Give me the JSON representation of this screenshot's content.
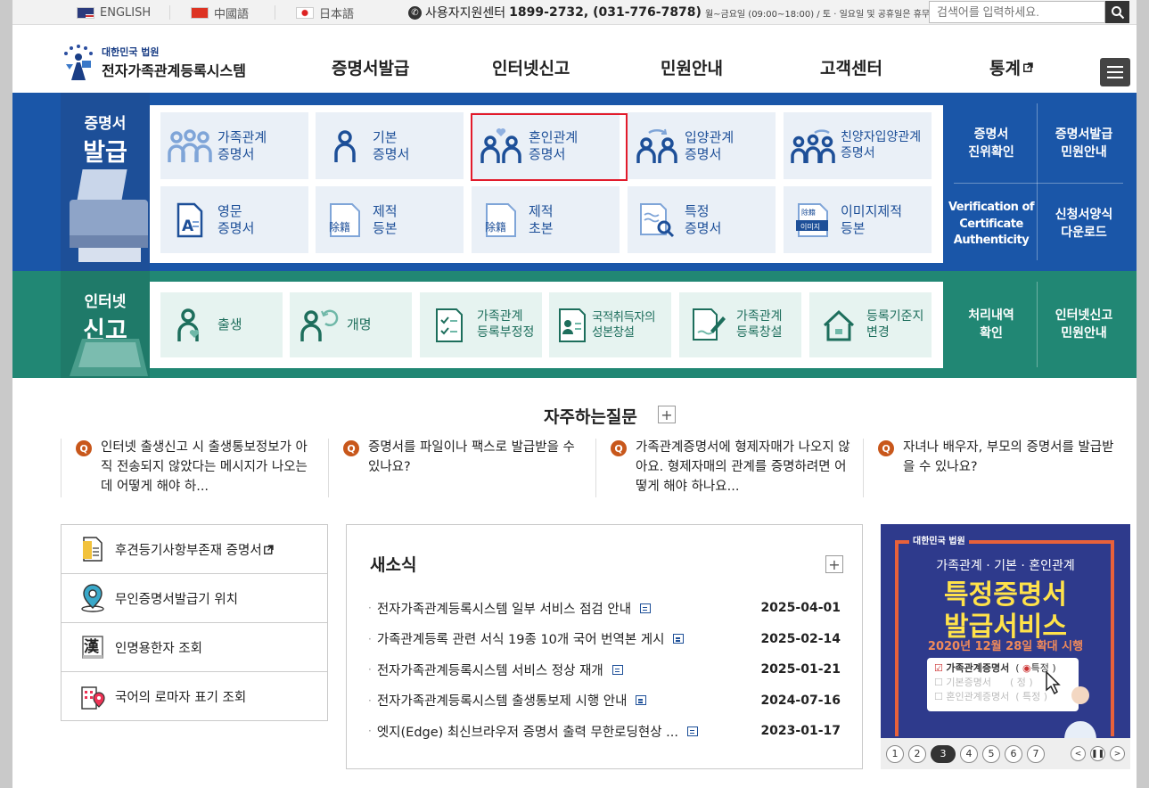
{
  "topbar": {
    "languages": [
      {
        "label": "ENGLISH"
      },
      {
        "label": "中國語"
      },
      {
        "label": "日本語"
      }
    ],
    "support_label": "사용자지원센터",
    "support_phone": "1899-2732, (031-776-7878)",
    "support_hours": "월~금요일 (09:00~18:00) / 토 · 일요일 및 공휴일은 휴무",
    "search_placeholder": "검색어를 입력하세요."
  },
  "header": {
    "logo_sub": "대한민국 법원",
    "logo_main": "전자가족관계등록시스템",
    "nav": [
      "증명서발급",
      "인터넷신고",
      "민원안내",
      "고객센터",
      "통계"
    ]
  },
  "issue": {
    "title_small": "증명서",
    "title_big": "발급",
    "row1": [
      {
        "l1": "가족관계",
        "l2": "증명서"
      },
      {
        "l1": "기본",
        "l2": "증명서"
      },
      {
        "l1": "혼인관계",
        "l2": "증명서"
      },
      {
        "l1": "입양관계",
        "l2": "증명서"
      },
      {
        "l1": "친양자입양관계",
        "l2": "증명서"
      }
    ],
    "row2": [
      {
        "l1": "영문",
        "l2": "증명서"
      },
      {
        "l1": "제적",
        "l2": "등본"
      },
      {
        "l1": "제적",
        "l2": "초본"
      },
      {
        "l1": "특정",
        "l2": "증명서"
      },
      {
        "l1": "이미지제적",
        "l2": "등본"
      }
    ],
    "side_links": [
      {
        "l1": "증명서",
        "l2": "진위확인"
      },
      {
        "l1": "증명서발급",
        "l2": "민원안내"
      },
      {
        "l1": "Verification of",
        "l2": "Certificate",
        "l3": "Authenticity"
      },
      {
        "l1": "신청서양식",
        "l2": "다운로드"
      }
    ]
  },
  "report": {
    "title_small": "인터넷",
    "title_big": "신고",
    "items": [
      {
        "l1": "출생",
        "l2": ""
      },
      {
        "l1": "개명",
        "l2": ""
      },
      {
        "l1": "가족관계",
        "l2": "등록부정정"
      },
      {
        "l1": "국적취득자의",
        "l2": "성본창설"
      },
      {
        "l1": "가족관계",
        "l2": "등록창설"
      },
      {
        "l1": "등록기준지",
        "l2": "변경"
      }
    ],
    "side_links": [
      {
        "l1": "처리내역",
        "l2": "확인"
      },
      {
        "l1": "인터넷신고",
        "l2": "민원안내"
      }
    ]
  },
  "faq": {
    "title": "자주하는질문",
    "badge": "Q",
    "items": [
      "인터넷 출생신고 시 출생통보정보가 아직 전송되지 않았다는 메시지가 나오는데 어떻게 해야 하...",
      "증명서를 파일이나 팩스로 발급받을 수 있나요?",
      "가족관계증명서에 형제자매가 나오지 않아요. 형제자매의 관계를 증명하려면 어떻게 해야 하나요...",
      "자녀나 배우자, 부모의 증명서를 발급받을 수 있나요?"
    ]
  },
  "quick_links": [
    {
      "label": "후견등기사항부존재 증명서",
      "icon": "document-icon"
    },
    {
      "label": "무인증명서발급기 위치",
      "icon": "location-pin-icon"
    },
    {
      "label": "인명용한자 조회",
      "icon": "hanja-book-icon"
    },
    {
      "label": "국어의 로마자 표기 조회",
      "icon": "building-pin-icon"
    }
  ],
  "news": {
    "title": "새소식",
    "items": [
      {
        "title": "전자가족관계등록시스템 일부 서비스 점검 안내",
        "date": "2025-04-01"
      },
      {
        "title": "가족관계등록 관련 서식 19종 10개 국어 번역본 게시",
        "date": "2025-02-14"
      },
      {
        "title": "전자가족관계등록시스템 서비스 정상 재개",
        "date": "2025-01-21"
      },
      {
        "title": "전자가족관계등록시스템 출생통보제 시행 안내",
        "date": "2024-07-16"
      },
      {
        "title": "엣지(Edge) 최신브라우저 증명서 출력 무한로딩현상 ...",
        "date": "2023-01-17"
      }
    ]
  },
  "banner": {
    "org": "대한민국 법원",
    "subtitle": "가족관계 · 기본 · 혼인관계",
    "line1": "특정증명서",
    "line2": "발급서비스",
    "date": "2020년 12월 28일 확대 시행",
    "card_rows": [
      {
        "left": "가족관계증명서",
        "right": "특정"
      },
      {
        "left": "기본증명서",
        "right": "정"
      },
      {
        "left": "혼인관계증명서",
        "right": "특정"
      }
    ],
    "pages": [
      "1",
      "2",
      "3",
      "4",
      "5",
      "6",
      "7"
    ]
  },
  "colors": {
    "issue_band": "#1a56a8",
    "report_band": "#218774",
    "highlight": "#e21b2b",
    "faq_badge": "#c8571b"
  }
}
